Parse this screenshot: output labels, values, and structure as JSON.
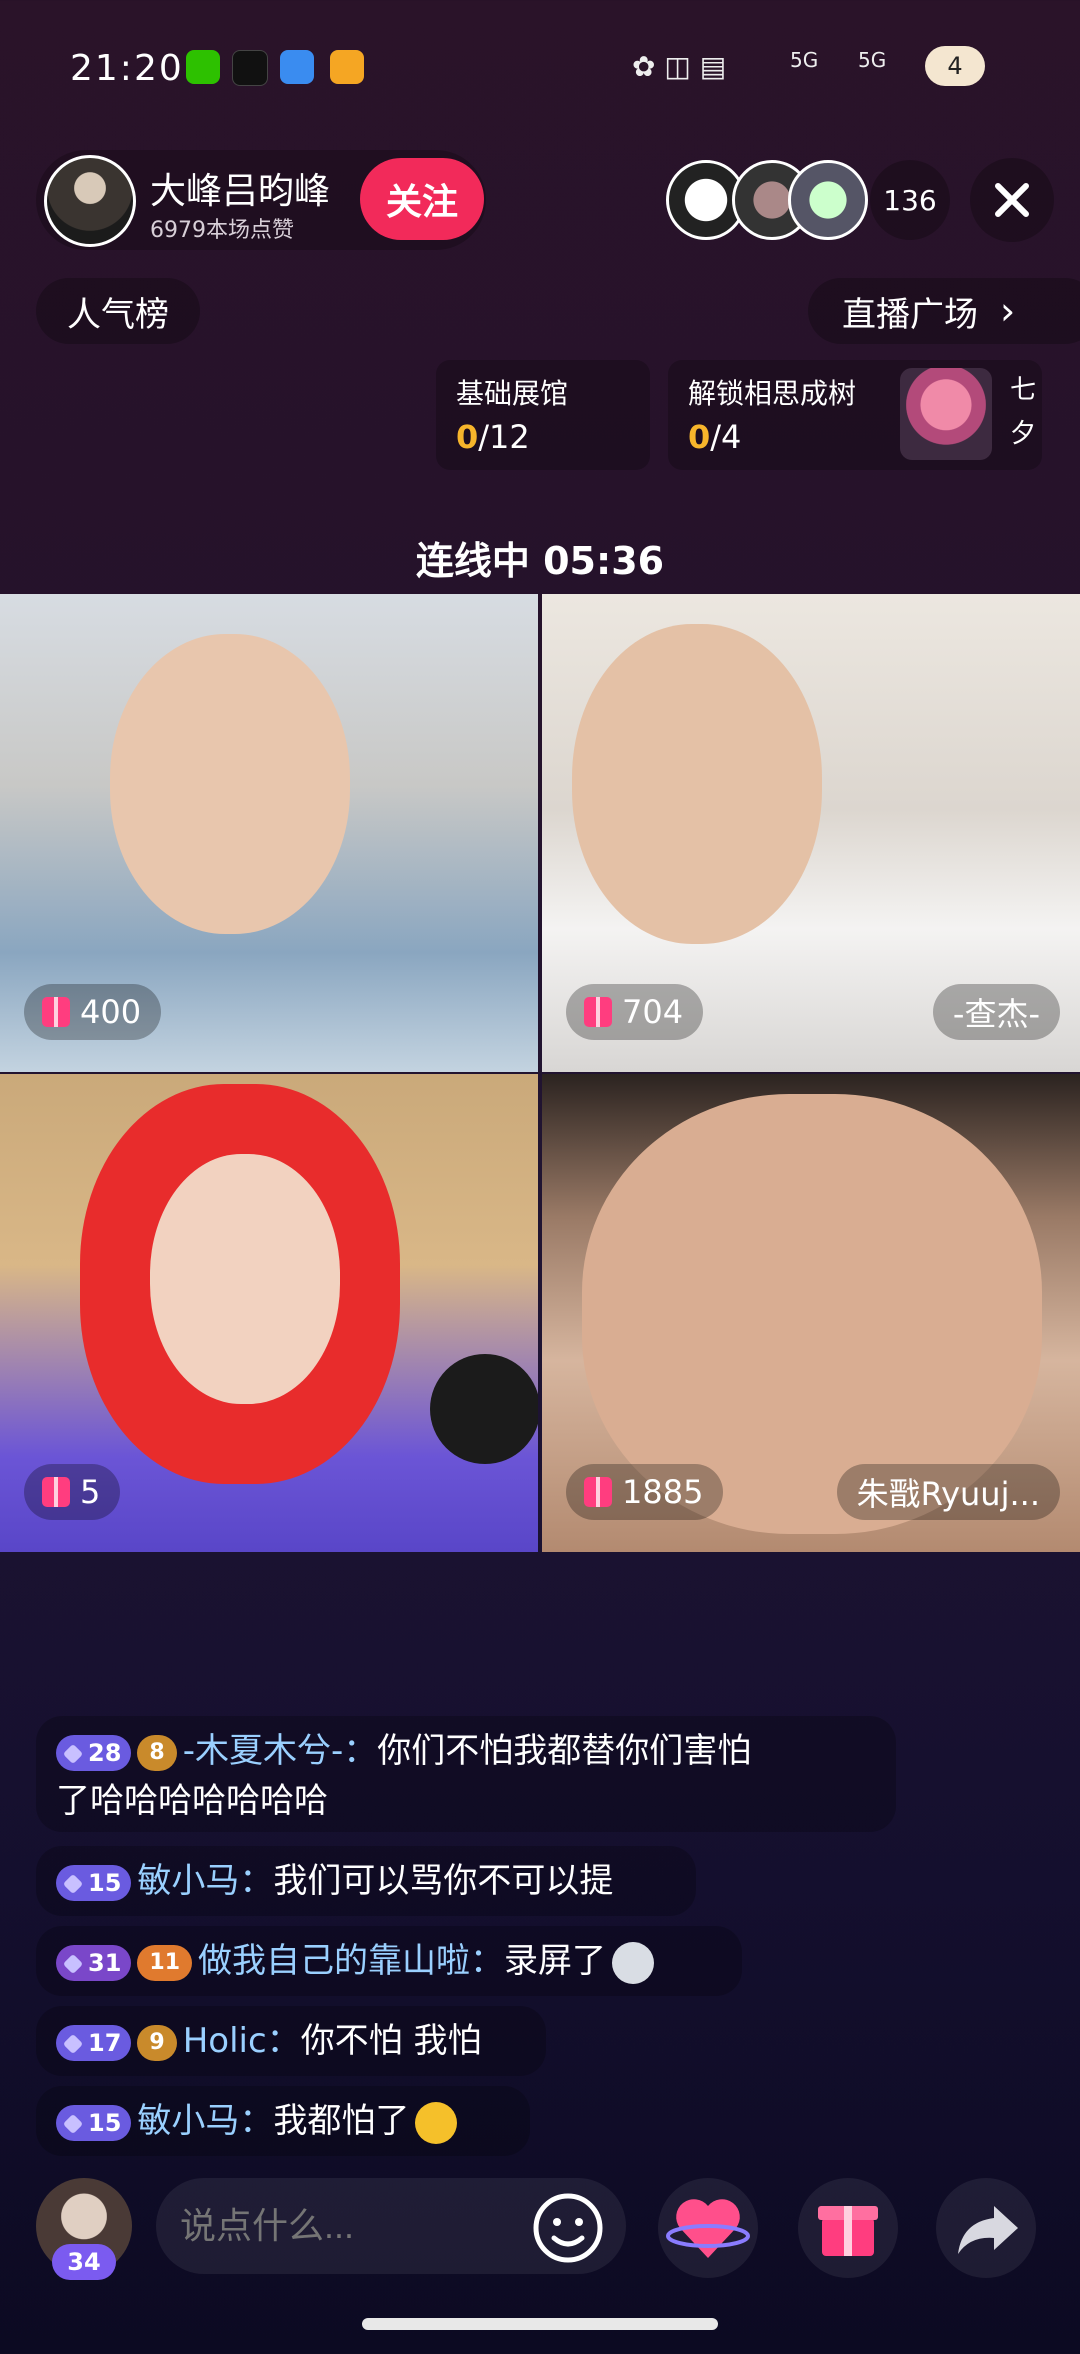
{
  "status_bar": {
    "time": "21:20",
    "apps": [
      "wechat-icon",
      "tiktok-icon",
      "weather-icon",
      "video-app-icon"
    ],
    "network": [
      "5G",
      "5G"
    ],
    "battery": "4"
  },
  "host": {
    "name": "大峰吕昀峰",
    "likes": "6979本场点赞",
    "follow_label": "关注"
  },
  "viewers": {
    "count": "136"
  },
  "nav": {
    "rank_label": "人气榜",
    "plaza_label": "直播广场"
  },
  "missions": [
    {
      "title": "基础展馆",
      "done": "0",
      "total": "/12"
    },
    {
      "title": "解锁相思成树",
      "done": "0",
      "total": "/4"
    }
  ],
  "side_text": "七夕",
  "timer": {
    "label": "连线中 05:36"
  },
  "tiles": [
    {
      "gift": "400",
      "name": ""
    },
    {
      "gift": "704",
      "name": "-查杰-"
    },
    {
      "gift": "5",
      "name": ""
    },
    {
      "gift": "1885",
      "name": "朱戬Ryuuj..."
    }
  ],
  "chat": [
    {
      "level": "28",
      "fan": "8",
      "user": "-木夏木兮-：",
      "text": "你们不怕我都替你们害怕",
      "cont": "了哈哈哈哈哈哈哈"
    },
    {
      "level": "15",
      "fan": "",
      "user": "敏小马：",
      "text": "我们可以骂你不可以提"
    },
    {
      "level": "31",
      "fan": "11",
      "user": "做我自己的靠山啦：",
      "text": "录屏了"
    },
    {
      "level": "17",
      "fan": "9",
      "user": "Holic：",
      "text": "你不怕 我怕"
    },
    {
      "level": "15",
      "fan": "",
      "user": "敏小马：",
      "text": "我都怕了"
    }
  ],
  "bottom": {
    "my_level": "34",
    "placeholder": "说点什么..."
  },
  "colors": {
    "follow": "#f22a5a",
    "progress": "#f7b52b",
    "gift": "#ff3d7f",
    "username": "#9ad0ff"
  }
}
